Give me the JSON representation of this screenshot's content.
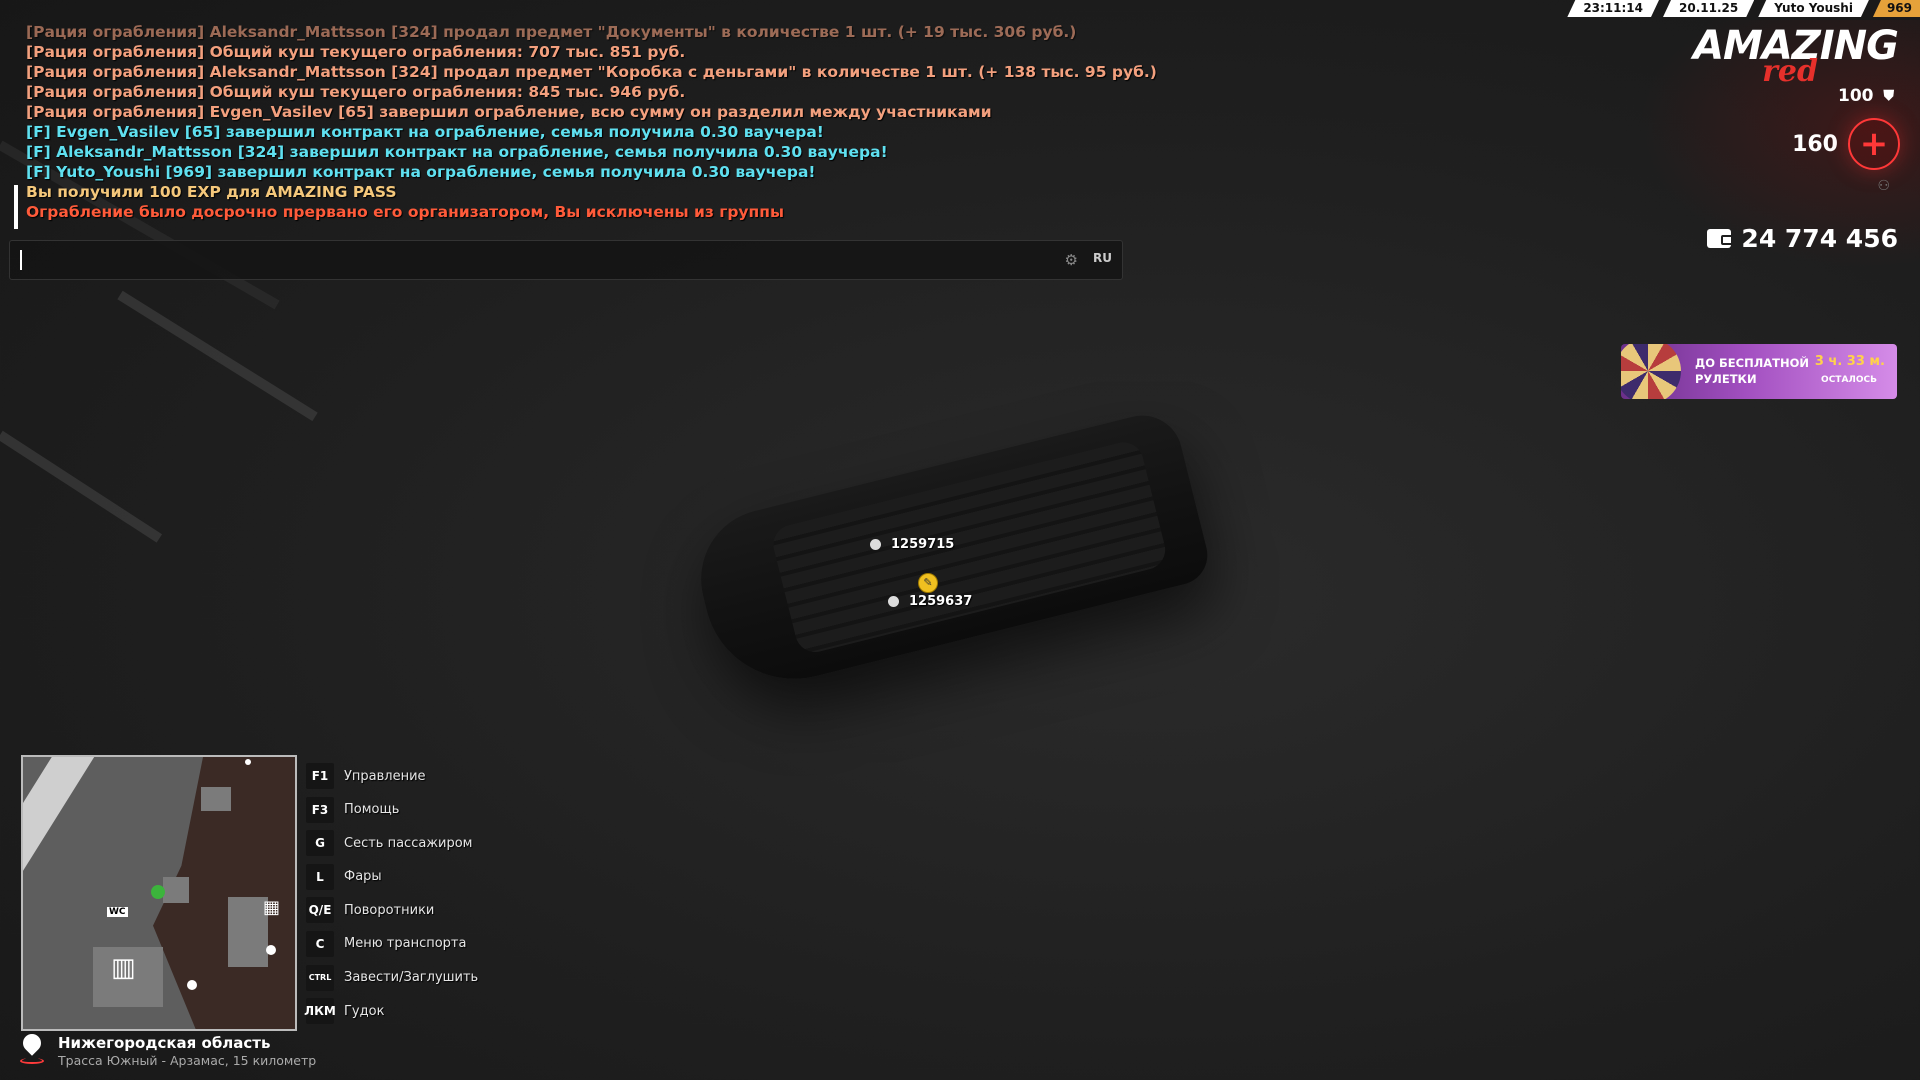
{
  "chat": {
    "lines": [
      {
        "text": "[Рация ограбления] Aleksandr_Mattsson [324] продал предмет \"Документы\" в количестве 1 шт. (+ 19 тыс. 306 руб.)",
        "color": "#f3a07e"
      },
      {
        "text": "[Рация ограбления] Общий куш текущего ограбления: 707 тыс. 851 руб.",
        "color": "#f3a07e"
      },
      {
        "text": "[Рация ограбления] Aleksandr_Mattsson [324] продал предмет \"Коробка с деньгами\" в количестве 1 шт. (+ 138 тыс. 95 руб.)",
        "color": "#f3a07e"
      },
      {
        "text": "[Рация ограбления] Общий куш текущего ограбления: 845 тыс. 946 руб.",
        "color": "#f3a07e"
      },
      {
        "text": "[Рация ограбления] Evgen_Vasilev [65] завершил ограбление, всю сумму он разделил между участниками",
        "color": "#f3a07e"
      },
      {
        "text": "[F] Evgen_Vasilev [65] завершил контракт на ограбление, семья получила 0.30 ваучера!",
        "color": "#5fe0f0"
      },
      {
        "text": "[F] Aleksandr_Mattsson [324] завершил контракт на ограбление, семья получила 0.30 ваучера!",
        "color": "#5fe0f0"
      },
      {
        "text": "[F] Yuto_Youshi [969] завершил контракт на ограбление, семья получила 0.30 ваучера!",
        "color": "#5fe0f0"
      },
      {
        "text": "Вы получили 100 EXP для AMAZING PASS",
        "color": "#f5c87b"
      },
      {
        "text": "Ограбление было досрочно прервано его организатором, Вы исключены из группы",
        "color": "#ff5b3a"
      }
    ],
    "input_value": "",
    "language": "RU"
  },
  "topbar": {
    "time": "23:11:14",
    "date": "20.11.25",
    "player": "Yuto Youshi",
    "id": "969"
  },
  "logo": {
    "main": "AMAZING",
    "sub": "red"
  },
  "stats": {
    "armor": "100",
    "health": "160",
    "money": "24 774 456"
  },
  "banner": {
    "title": "ДО БЕСПЛАТНОЙ РУЛЕТКИ",
    "time": "3 ч. 33 м.",
    "remaining": "ОСТАЛОСЬ"
  },
  "car": {
    "label_top": "1259715",
    "label_bottom": "1259637"
  },
  "minimap": {
    "wc_label": "WC"
  },
  "keys": [
    {
      "key": "F1",
      "label": "Управление"
    },
    {
      "key": "F3",
      "label": "Помощь"
    },
    {
      "key": "G",
      "label": "Сесть пассажиром"
    },
    {
      "key": "L",
      "label": "Фары"
    },
    {
      "key": "Q/E",
      "label": "Поворотники"
    },
    {
      "key": "C",
      "label": "Меню транспорта"
    },
    {
      "key": "CTRL",
      "label": "Завести/Заглушить"
    },
    {
      "key": "ЛКМ",
      "label": "Гудок"
    }
  ],
  "location": {
    "region": "Нижегородская область",
    "road": "Трасса Южный - Арзамас, 15 километр"
  },
  "colors": {
    "accent_red": "#ff3838",
    "chat_orange": "#f3a07e",
    "chat_cyan": "#5fe0f0",
    "banner_purple": "#a24fc0"
  }
}
